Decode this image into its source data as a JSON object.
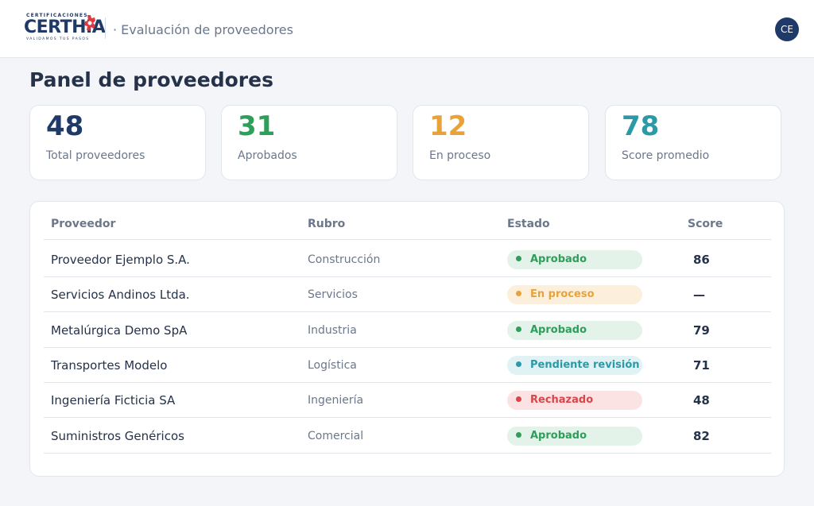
{
  "header": {
    "logo_top": "CERTIFICACIONES",
    "logo_word": "CERTHIA",
    "logo_sub": "VALIDAMOS TUS PASOS",
    "title": "· Evaluación de proveedores",
    "avatar_initials": "CE"
  },
  "page": {
    "title": "Panel de proveedores"
  },
  "stats": [
    {
      "value": "48",
      "label": "Total proveedores",
      "color": "#1f3a68"
    },
    {
      "value": "31",
      "label": "Aprobados",
      "color": "#2e9e5b"
    },
    {
      "value": "12",
      "label": "En proceso",
      "color": "#e8a23a"
    },
    {
      "value": "78",
      "label": "Score promedio",
      "color": "#2b9aa6"
    }
  ],
  "table": {
    "headers": {
      "proveedor": "Proveedor",
      "rubro": "Rubro",
      "estado": "Estado",
      "score": "Score"
    },
    "rows": [
      {
        "proveedor": "Proveedor Ejemplo S.A.",
        "rubro": "Construcción",
        "estado": "Aprobado",
        "score": "86"
      },
      {
        "proveedor": "Servicios Andinos Ltda.",
        "rubro": "Servicios",
        "estado": "En proceso",
        "score": "—"
      },
      {
        "proveedor": "Metalúrgica Demo SpA",
        "rubro": "Industria",
        "estado": "Aprobado",
        "score": "79"
      },
      {
        "proveedor": "Transportes Modelo",
        "rubro": "Logística",
        "estado": "Pendiente revisión",
        "score": "71"
      },
      {
        "proveedor": "Ingeniería Ficticia SA",
        "rubro": "Ingeniería",
        "estado": "Rechazado",
        "score": "48"
      },
      {
        "proveedor": "Suministros Genéricos",
        "rubro": "Comercial",
        "estado": "Aprobado",
        "score": "82"
      }
    ]
  },
  "status_colors": {
    "Aprobado": {
      "fg": "#2e9e5b",
      "bg": "#e3f3e9"
    },
    "En proceso": {
      "fg": "#e8a23a",
      "bg": "#fcf0dd"
    },
    "Pendiente revisión": {
      "fg": "#2b9aa6",
      "bg": "#e0f2f4"
    },
    "Rechazado": {
      "fg": "#d9454b",
      "bg": "#fbe3e4"
    }
  }
}
